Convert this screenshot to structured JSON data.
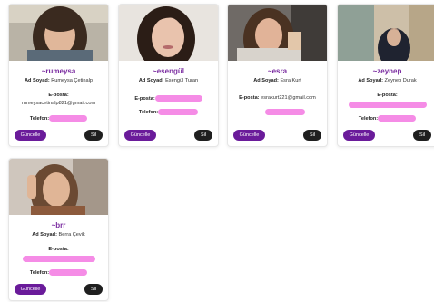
{
  "labels": {
    "fullname": "Ad Soyad:",
    "email": "E-posta:",
    "phone": "Telefon:",
    "update_button": "Güncelle",
    "delete_button": "Sil"
  },
  "colors": {
    "username": "#7a2ca0",
    "update_button": "#6a1b9a",
    "delete_button": "#1f1f1f",
    "redaction": "#f58ce6"
  },
  "users": [
    {
      "username": "~rumeysa",
      "fullname": "Rumeysa Çetinalp",
      "email": "rumeysacetinalp821@gmail.com",
      "phone": ""
    },
    {
      "username": "~esengül",
      "fullname": "Esengül Turan",
      "email": "",
      "phone": ""
    },
    {
      "username": "~esra",
      "fullname": "Esra Kurt",
      "email": "esrakurt221@gmail.com",
      "phone": ""
    },
    {
      "username": "~zeynep",
      "fullname": "Zeynep Durak",
      "email": "",
      "phone": ""
    },
    {
      "username": "~brr",
      "fullname": "Berra Çevik",
      "email": "",
      "phone": ""
    }
  ]
}
